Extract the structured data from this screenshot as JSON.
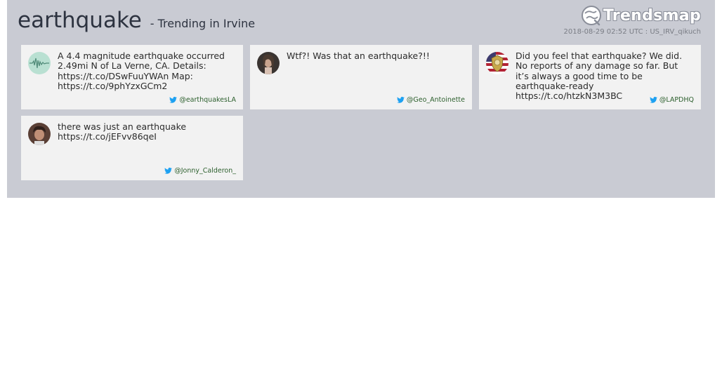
{
  "header": {
    "topic": "earthquake",
    "subtitle": "- Trending in Irvine",
    "logo_text": "Trendsmap",
    "meta": "2018-08-29 02:52 UTC : US_IRV_qikuch"
  },
  "tweets": [
    {
      "text": "A 4.4 magnitude earthquake occurred 2.49mi N of La Verne, CA. Details: https://t.co/DSwFuuYWAn Map: https://t.co/9phYzxGCm2",
      "handle": "@earthquakesLA",
      "avatar": "seismograph-avatar"
    },
    {
      "text": "Wtf?! Was that an earthquake?!!",
      "handle": "@Geo_Antoinette",
      "avatar": "user-photo-avatar"
    },
    {
      "text": "Did you feel that earthquake? We did. No reports of any damage so far. But it’s always a good time to be earthquake-ready https://t.co/htzkN3M3BC",
      "handle": "@LAPDHQ",
      "avatar": "police-badge-avatar"
    },
    {
      "text": "there was just an earthquake https://t.co/jEFvv86qeI",
      "handle": "@Jonny_Calderon_",
      "avatar": "user-photo-avatar"
    }
  ],
  "colors": {
    "panel": "#c9cbd3",
    "card": "#f2f2f2",
    "handle": "#2c5f2d",
    "twitter_bird": "#1da1f2"
  }
}
